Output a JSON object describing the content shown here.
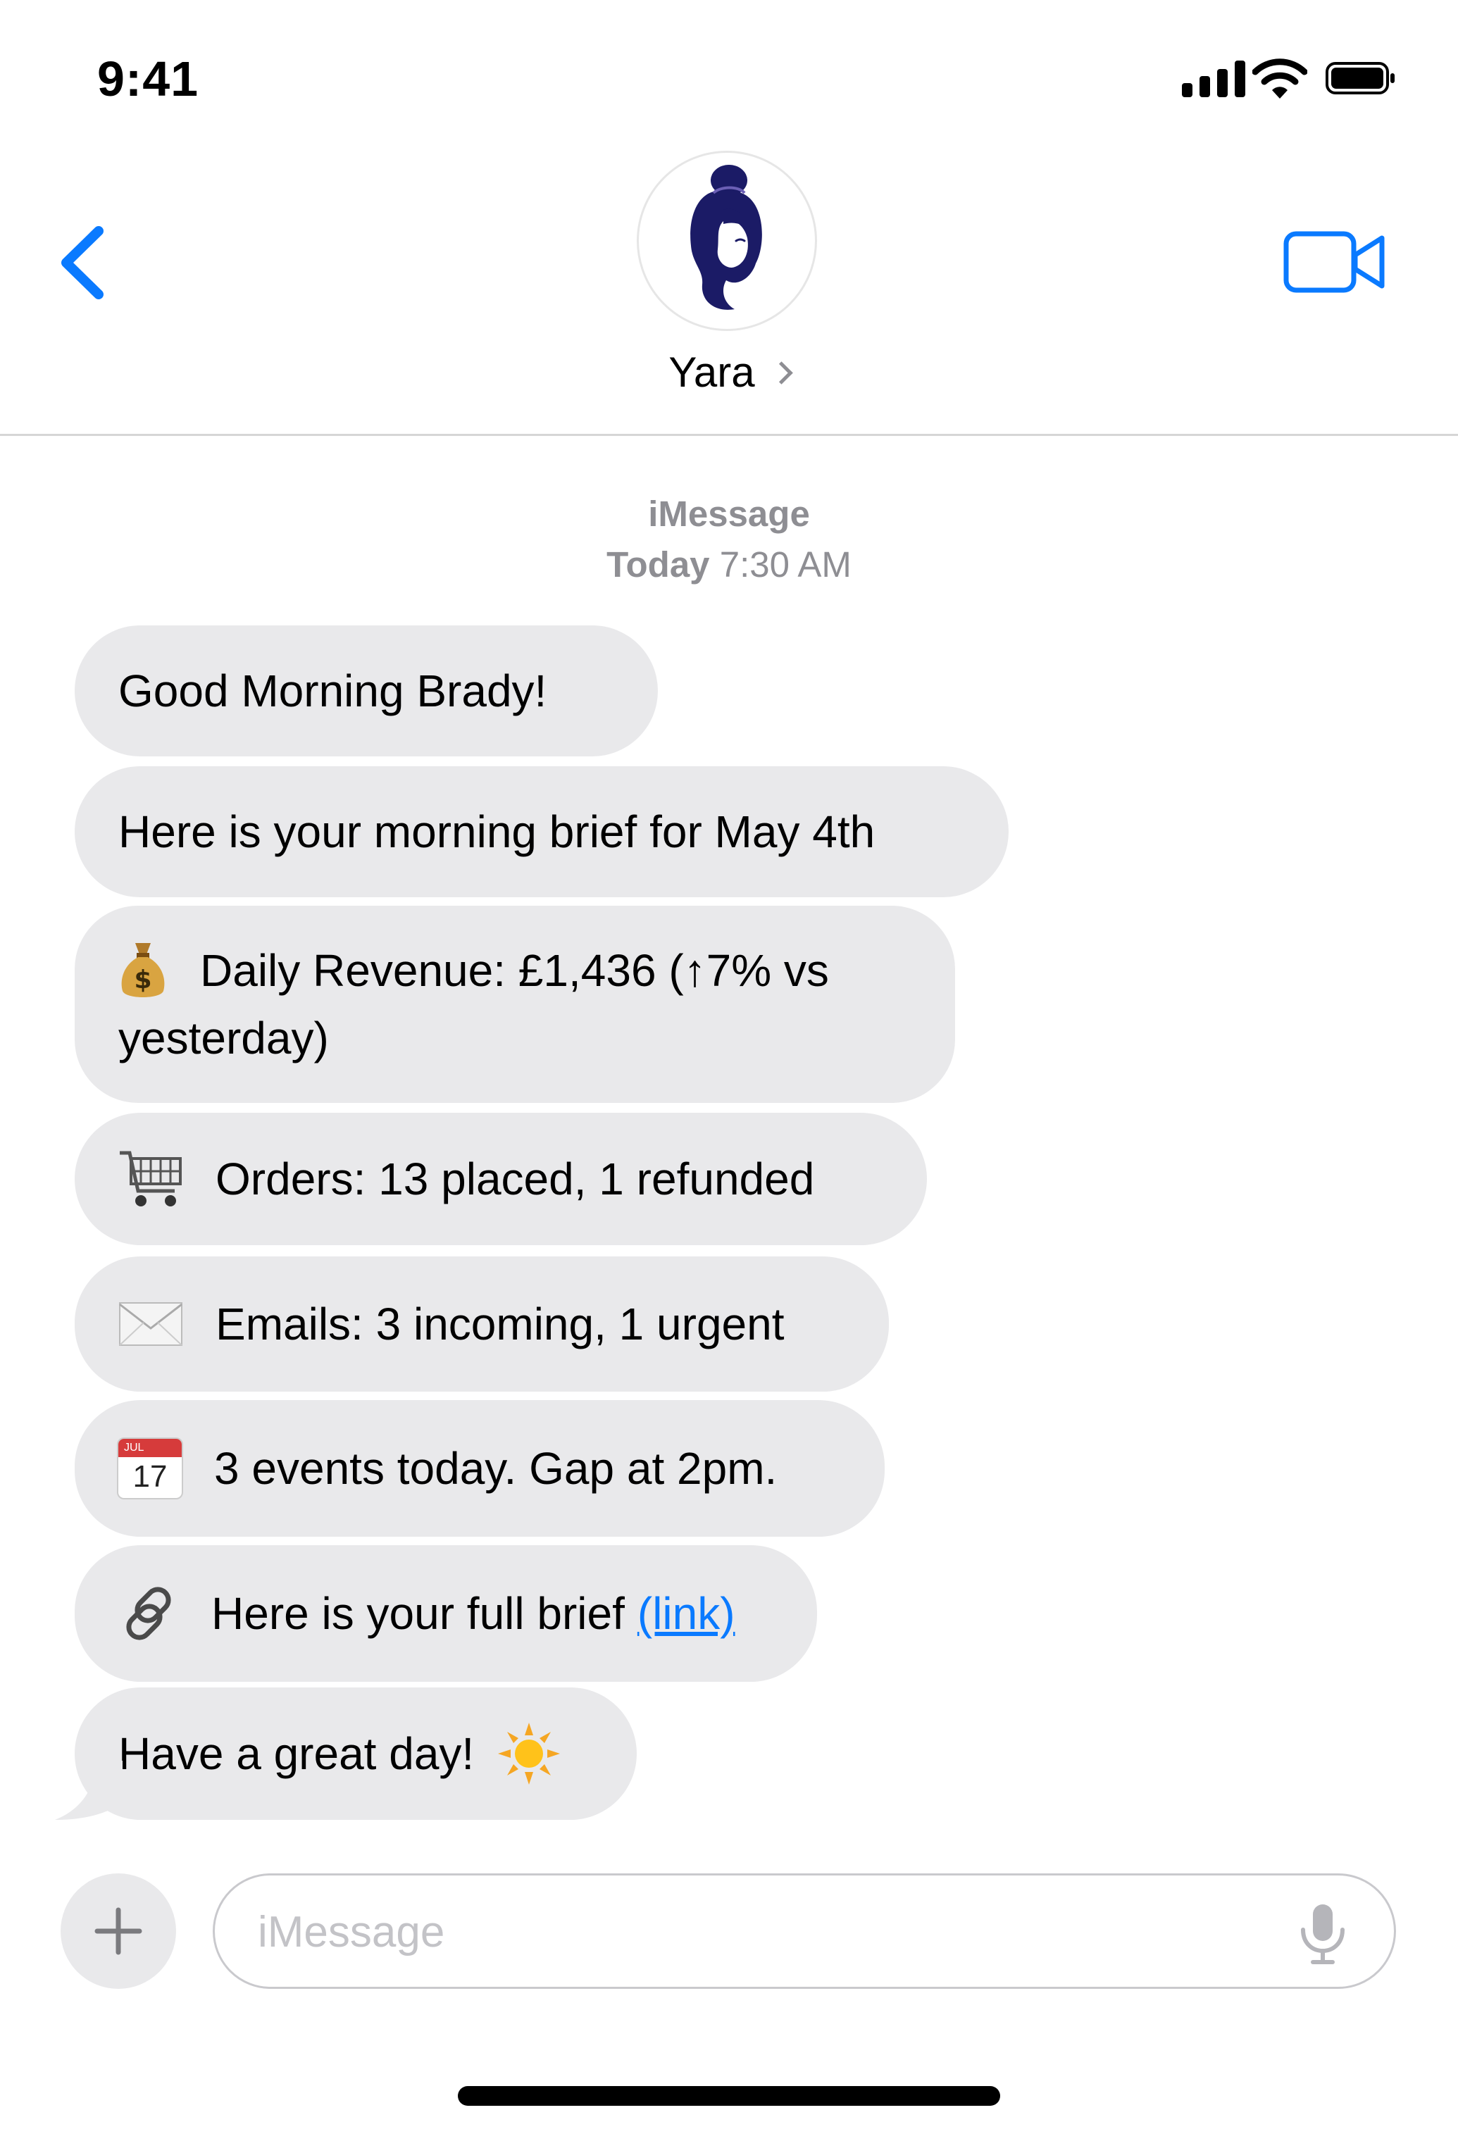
{
  "status_bar": {
    "time": "9:41"
  },
  "header": {
    "contact_name": "Yara",
    "back_icon": "chevron-left-icon",
    "video_icon": "video-camera-icon",
    "accent": "#0a7aff"
  },
  "thread_meta": {
    "service": "iMessage",
    "day": "Today",
    "time": "7:30 AM"
  },
  "messages": [
    {
      "text": "Good Morning Brady!"
    },
    {
      "text": "Here is your morning brief for May 4th"
    },
    {
      "emoji": "money-bag-icon",
      "line1": "Daily Revenue: £1,436 (↑7% vs",
      "line2": "yesterday)"
    },
    {
      "emoji": "shopping-cart-icon",
      "text": "Orders: 13 placed, 1 refunded"
    },
    {
      "emoji": "envelope-icon",
      "text": "Emails: 3 incoming, 1 urgent"
    },
    {
      "emoji": "calendar-icon",
      "calendar_month": "JUL",
      "calendar_day": "17",
      "text": "3 events today. Gap at 2pm."
    },
    {
      "emoji": "link-icon",
      "text": "Here is your full brief",
      "link_text": "(link)"
    },
    {
      "text": "Have a great day!",
      "emoji": "sun-icon"
    }
  ],
  "compose": {
    "placeholder": "iMessage",
    "plus_icon": "plus-icon",
    "mic_icon": "microphone-icon"
  },
  "colors": {
    "bubble": "#e9e9eb",
    "meta_text": "#8e8e93",
    "avatar": "#1b1b66"
  }
}
